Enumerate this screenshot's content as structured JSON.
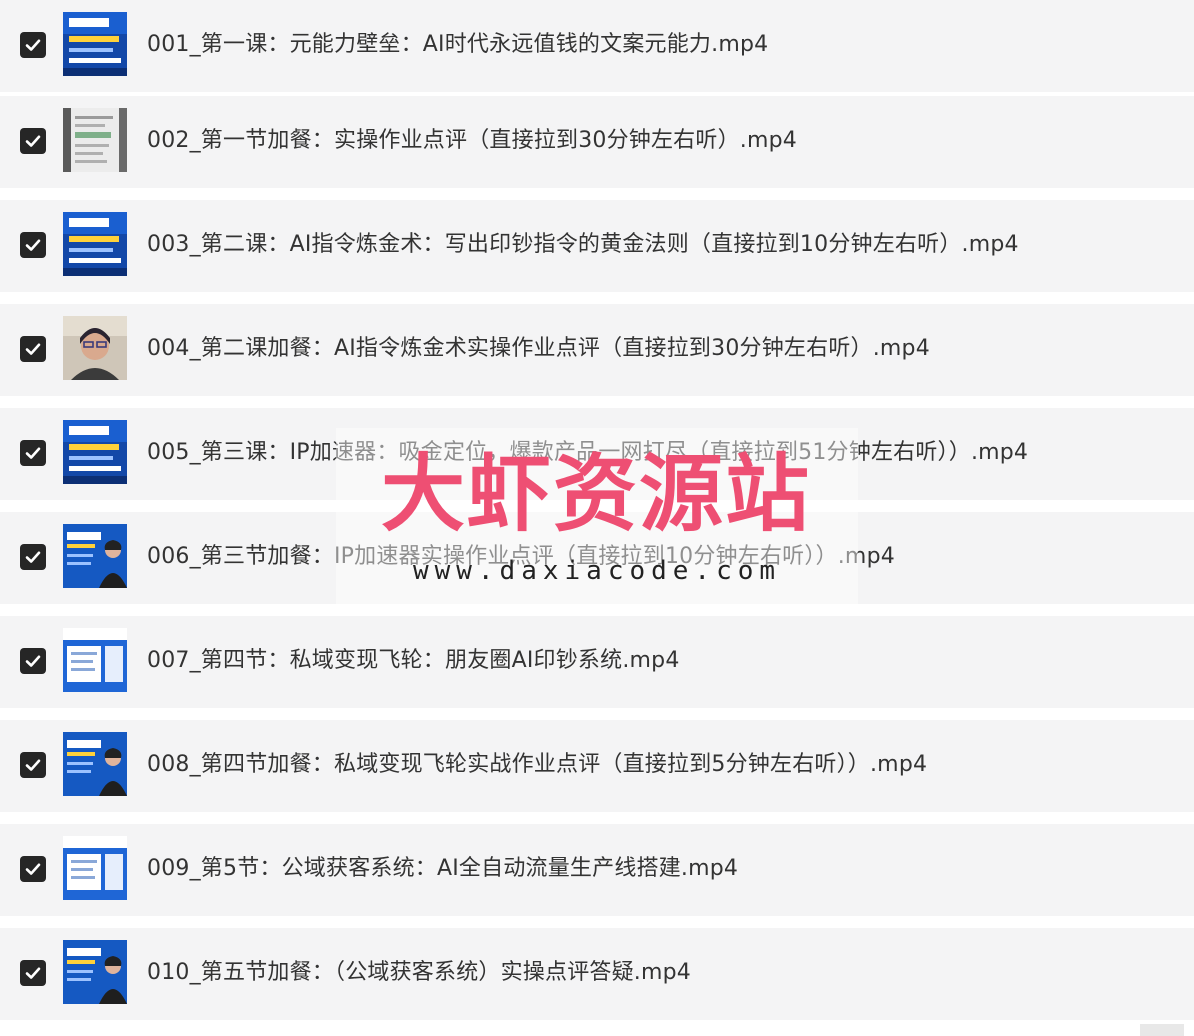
{
  "items": [
    {
      "label": "001_第一课：元能力壁垒：AI时代永远值钱的文案元能力.mp4",
      "checked": true,
      "thumb": "poster"
    },
    {
      "label": "002_第一节加餐：实操作业点评（直接拉到30分钟左右听）.mp4",
      "checked": true,
      "thumb": "document"
    },
    {
      "label": "003_第二课：AI指令炼金术：写出印钞指令的黄金法则（直接拉到10分钟左右听）.mp4",
      "checked": true,
      "thumb": "poster"
    },
    {
      "label": "004_第二课加餐：AI指令炼金术实操作业点评（直接拉到30分钟左右听）.mp4",
      "checked": true,
      "thumb": "person"
    },
    {
      "label": "005_第三课：IP加速器：吸金定位，爆款产品一网打尽（直接拉到51分钟左右听））.mp4",
      "checked": true,
      "thumb": "poster"
    },
    {
      "label": "006_第三节加餐：IP加速器实操作业点评（直接拉到10分钟左右听））.mp4",
      "checked": true,
      "thumb": "poster-person"
    },
    {
      "label": "007_第四节：私域变现飞轮：朋友圈AI印钞系统.mp4",
      "checked": true,
      "thumb": "slide"
    },
    {
      "label": "008_第四节加餐：私域变现飞轮实战作业点评（直接拉到5分钟左右听））.mp4",
      "checked": true,
      "thumb": "poster-person"
    },
    {
      "label": "009_第5节：公域获客系统：AI全自动流量生产线搭建.mp4",
      "checked": true,
      "thumb": "slide"
    },
    {
      "label": "010_第五节加餐：（公域获客系统）实操点评答疑.mp4",
      "checked": true,
      "thumb": "poster-person"
    }
  ],
  "watermark": {
    "title": "大虾资源站",
    "url": "www.daxiacode.com"
  },
  "colors": {
    "row_bg": "#f4f4f5",
    "checkbox": "#262626",
    "text": "#333333",
    "watermark_title": "#ee4f73"
  }
}
